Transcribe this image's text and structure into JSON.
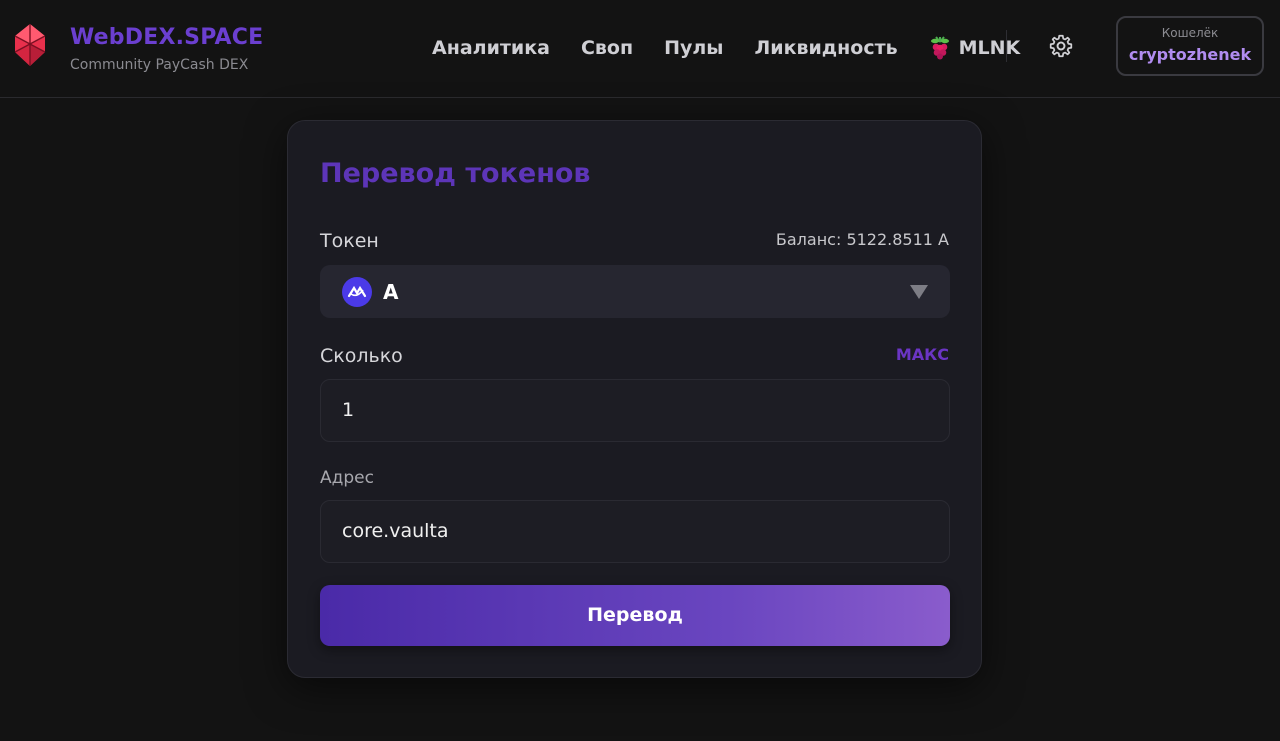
{
  "header": {
    "brand_title": "WebDEX.SPACE",
    "brand_subtitle": "Community PayCash DEX",
    "logo_icon": "eos-crystal-icon",
    "nav": [
      {
        "label": "Аналитика"
      },
      {
        "label": "Своп"
      },
      {
        "label": "Пулы"
      },
      {
        "label": "Ликвидность"
      },
      {
        "label": "MLNK",
        "icon": "raspberry-icon"
      }
    ],
    "settings_icon": "gear-icon",
    "wallet": {
      "label": "Кошелёк",
      "account": "cryptozhenek"
    }
  },
  "transfer": {
    "title": "Перевод токенов",
    "token_label": "Токен",
    "balance_text": "Баланс: 5122.8511 A",
    "token": {
      "symbol": "A",
      "icon": "token-a-icon"
    },
    "amount_label": "Сколько",
    "max_label": "МАКС",
    "amount_value": "1",
    "address_label": "Адрес",
    "address_value": "core.vaulta",
    "submit_label": "Перевод"
  },
  "colors": {
    "background": "#131313",
    "brand": "#6b3fd0",
    "accent_start": "#4a2aa8",
    "accent_end": "#8a5ccc",
    "card": "#1b1b22",
    "wallet_name": "#b18cf0"
  }
}
